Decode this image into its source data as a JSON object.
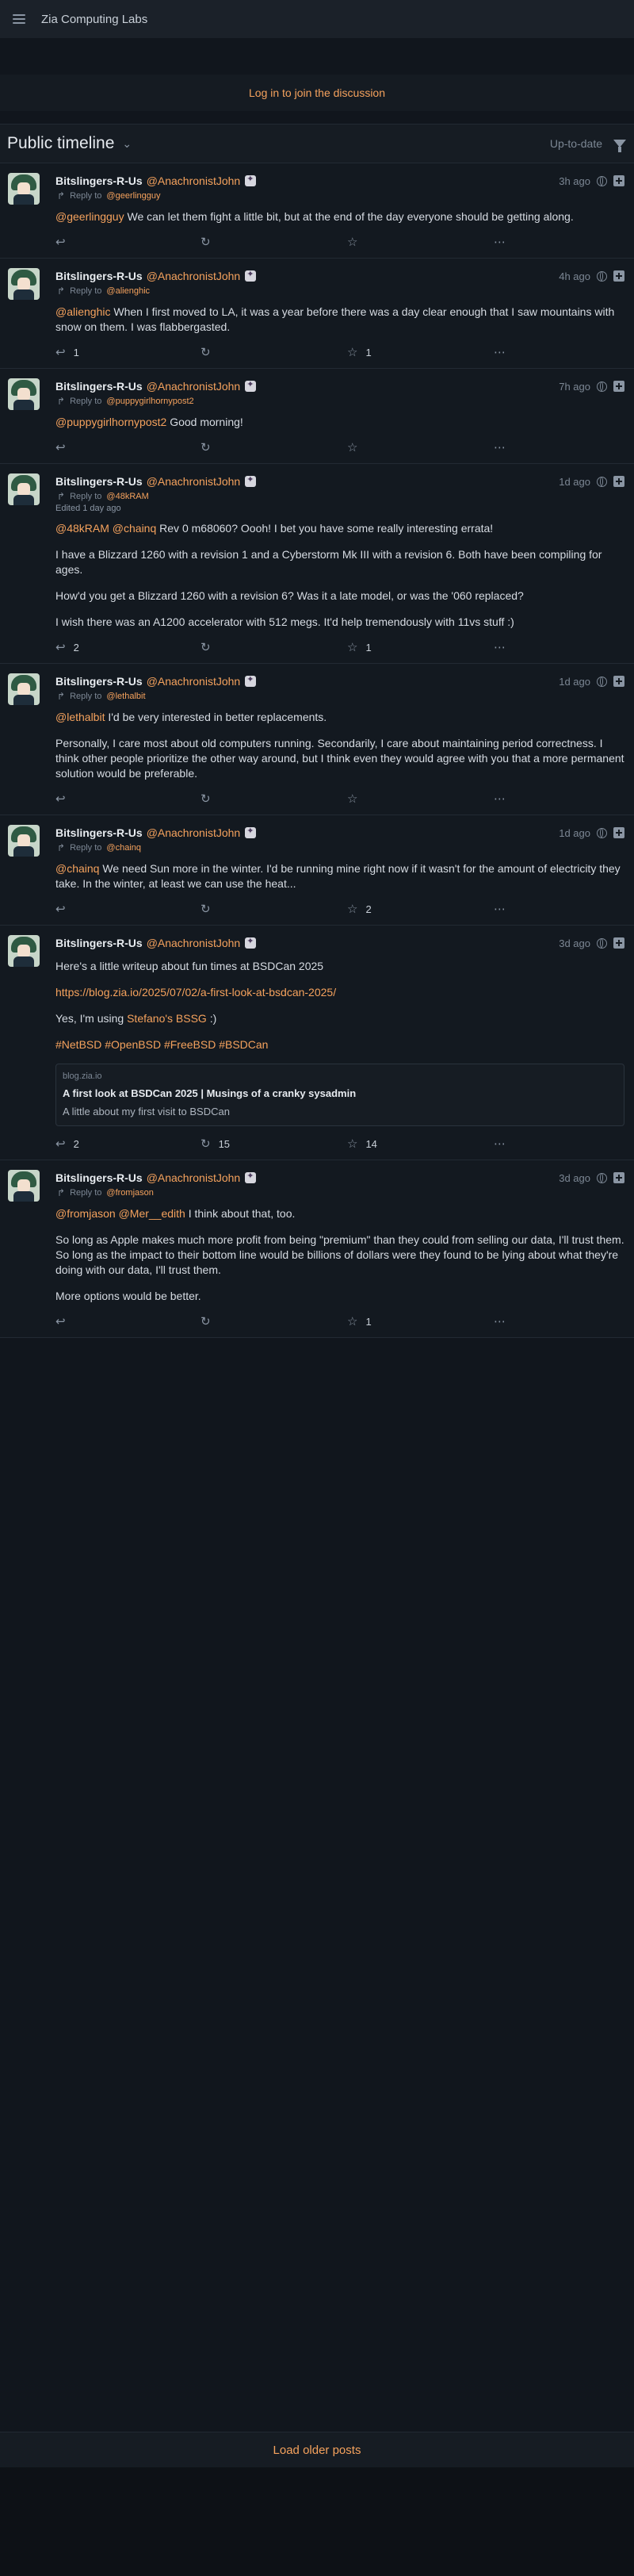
{
  "site": {
    "title": "Zia Computing Labs",
    "login_text": "Log in to join the discussion"
  },
  "timeline": {
    "title": "Public timeline",
    "status": "Up-to-date"
  },
  "posts": [
    {
      "author": "Bitslingers-R-Us",
      "handle": "@AnachronistJohn",
      "time": "3h ago",
      "reply_label": "Reply to",
      "reply_to": "@geerlingguy",
      "mentions": "@geerlingguy",
      "paragraphs": [
        "We can let them fight a little bit, but at the end of the day everyone should be getting along."
      ],
      "replies": "",
      "boosts": "",
      "favs": ""
    },
    {
      "author": "Bitslingers-R-Us",
      "handle": "@AnachronistJohn",
      "time": "4h ago",
      "reply_label": "Reply to",
      "reply_to": "@alienghic",
      "mentions": "@alienghic",
      "paragraphs": [
        "When I first moved to LA, it was a year before there was a day clear enough that I saw mountains with snow on them. I was flabbergasted."
      ],
      "replies": "1",
      "boosts": "",
      "favs": "1"
    },
    {
      "author": "Bitslingers-R-Us",
      "handle": "@AnachronistJohn",
      "time": "7h ago",
      "reply_label": "Reply to",
      "reply_to": "@puppygirlhornypost2",
      "mentions": "@puppygirlhornypost2",
      "paragraphs": [
        "Good morning!"
      ],
      "replies": "",
      "boosts": "",
      "favs": ""
    },
    {
      "author": "Bitslingers-R-Us",
      "handle": "@AnachronistJohn",
      "time": "1d ago",
      "reply_label": "Reply to",
      "reply_to": "@48kRAM",
      "edited": "Edited 1 day ago",
      "mentions": "@48kRAM @chainq",
      "paragraphs": [
        "Rev 0 m68060? Oooh! I bet you have some really interesting errata!",
        "I have a Blizzard 1260 with a revision 1 and a Cyberstorm Mk III with a revision 6. Both have been compiling for ages.",
        "How'd you get a Blizzard 1260 with a revision 6? Was it a late model, or was the '060 replaced?",
        "I wish there was an A1200 accelerator with 512 megs. It'd help tremendously with 11vs stuff :)"
      ],
      "replies": "2",
      "boosts": "",
      "favs": "1"
    },
    {
      "author": "Bitslingers-R-Us",
      "handle": "@AnachronistJohn",
      "time": "1d ago",
      "reply_label": "Reply to",
      "reply_to": "@lethalbit",
      "mentions": "@lethalbit",
      "paragraphs": [
        "I'd be very interested in better replacements.",
        "Personally, I care most about old computers running. Secondarily, I care about maintaining period correctness. I think other people prioritize the other way around, but I think even they would agree with you that a more permanent solution would be preferable."
      ],
      "replies": "",
      "boosts": "",
      "favs": ""
    },
    {
      "author": "Bitslingers-R-Us",
      "handle": "@AnachronistJohn",
      "time": "1d ago",
      "reply_label": "Reply to",
      "reply_to": "@chainq",
      "mentions": "@chainq",
      "paragraphs": [
        "We need Sun more in the winter. I'd be running mine right now if it wasn't for the amount of electricity they take. In the winter, at least we can use the heat..."
      ],
      "replies": "",
      "boosts": "",
      "favs": "2"
    },
    {
      "author": "Bitslingers-R-Us",
      "handle": "@AnachronistJohn",
      "time": "3d ago",
      "intro": "Here's a little writeup about fun times at BSDCan 2025",
      "url": "https://blog.zia.io/2025/07/02/a-first-look-at-bsdcan-2025/",
      "bssg_prefix": "Yes, I'm using ",
      "bssg_link": "Stefano's BSSG",
      "bssg_suffix": " :)",
      "hashtags": "#NetBSD #OpenBSD #FreeBSD #BSDCan",
      "card": {
        "domain": "blog.zia.io",
        "title": "A first look at BSDCan 2025 | Musings of a cranky sysadmin",
        "desc": "A little about my first visit to BSDCan"
      },
      "replies": "2",
      "boosts": "15",
      "favs": "14"
    },
    {
      "author": "Bitslingers-R-Us",
      "handle": "@AnachronistJohn",
      "time": "3d ago",
      "reply_label": "Reply to",
      "reply_to": "@fromjason",
      "mentions": "@fromjason @Mer__edith",
      "paragraphs": [
        "I think about that, too.",
        "So long as Apple makes much more profit from being \"premium\" than they could from selling our data, I'll trust them. So long as the impact to their bottom line would be billions of dollars were they found to be lying about what they're doing with our data, I'll trust them.",
        "More options would be better."
      ],
      "replies": "",
      "boosts": "",
      "favs": "1"
    }
  ],
  "footer": {
    "load_more": "Load older posts"
  },
  "icons": {
    "menu": "hamburger-icon",
    "chevron": "chevron-down-icon",
    "filter": "filter-icon",
    "reply": "reply-icon",
    "boost": "boost-icon",
    "fav": "star-icon",
    "more": "more-icon",
    "globe": "globe-icon",
    "expand": "plus-icon",
    "bot": "bot-icon"
  },
  "colors": {
    "accent": "#f5a25d",
    "background": "#11161d",
    "text": "#d6dbe2",
    "muted": "#7c8794"
  }
}
